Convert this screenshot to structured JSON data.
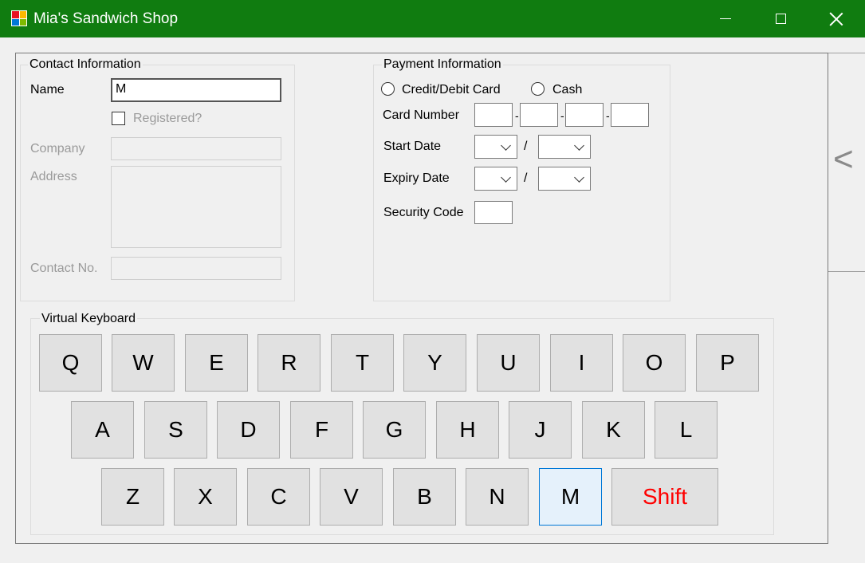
{
  "window": {
    "title": "Mia's Sandwich Shop"
  },
  "contact": {
    "group_title": "Contact Information",
    "name_label": "Name",
    "name_value": "M",
    "registered_label": "Registered?",
    "company_label": "Company",
    "address_label": "Address",
    "contact_no_label": "Contact No."
  },
  "payment": {
    "group_title": "Payment Information",
    "credit_label": "Credit/Debit Card",
    "cash_label": "Cash",
    "card_number_label": "Card Number",
    "card_separator": "-",
    "start_date_label": "Start Date",
    "expiry_date_label": "Expiry Date",
    "date_separator": "/",
    "security_code_label": "Security Code"
  },
  "keyboard": {
    "group_title": "Virtual Keyboard",
    "row1": [
      "Q",
      "W",
      "E",
      "R",
      "T",
      "Y",
      "U",
      "I",
      "O",
      "P"
    ],
    "row2": [
      "A",
      "S",
      "D",
      "F",
      "G",
      "H",
      "J",
      "K",
      "L"
    ],
    "row3": [
      "Z",
      "X",
      "C",
      "V",
      "B",
      "N",
      "M"
    ],
    "shift_label": "Shift",
    "active_key": "M",
    "shift_color": "#ff0000"
  },
  "side_tab": {
    "label": "<"
  },
  "colors": {
    "titlebar": "#107c10",
    "active_key_border": "#0078d7"
  }
}
